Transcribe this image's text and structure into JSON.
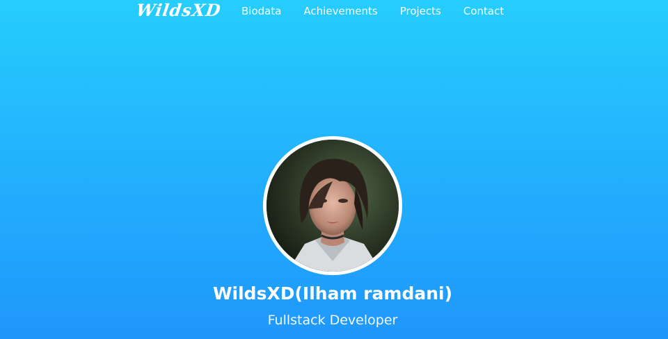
{
  "navbar": {
    "brand": "WildsXD",
    "links": [
      {
        "label": "Biodata"
      },
      {
        "label": "Achievements"
      },
      {
        "label": "Projects"
      },
      {
        "label": "Contact"
      }
    ]
  },
  "profile": {
    "name": "WildsXD(Ilham ramdani)",
    "role": "Fullstack Developer"
  },
  "colors": {
    "background_top": "#26cdfd",
    "background_bottom": "#1f97fc",
    "text": "#ffffff"
  }
}
